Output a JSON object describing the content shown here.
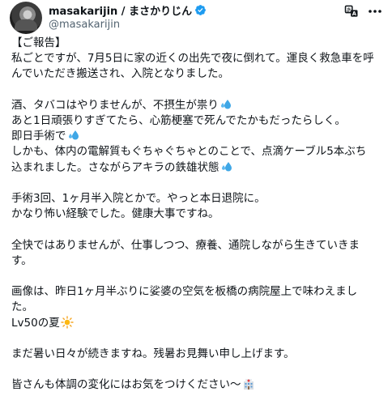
{
  "author": {
    "display_name": "masakarijin / まさかりじん",
    "handle": "@masakarijin",
    "verified_icon": "verified-badge-icon",
    "verified_color": "#1d9bf0"
  },
  "actions": {
    "translate_icon": "translate-icon",
    "more_icon": "more-icon"
  },
  "post": {
    "paragraphs": [
      [
        "【ご報告】",
        "私ごとですが、7月5日に家の近くの出先で夜に倒れて。運良く救急車を呼",
        "んでいただき搬送され、入院となりました。"
      ],
      [
        "酒、タバコはやりませんが、不摂生が祟り",
        "あと1日頑張りすぎてたら、心筋梗塞で死んでたかもだったらしく。",
        "即日手術で",
        "しかも、体内の電解質もぐちゃぐちゃとのことで、点滴ケーブル5本ぶち",
        "込まれました。さながらアキラの鉄雄状態"
      ],
      [
        "手術3回、1ヶ月半入院とかで。やっと本日退院に。",
        "かなり怖い経験でした。健康大事ですね。"
      ],
      [
        "全快ではありませんが、仕事しつつ、療養、通院しながら生きていきま",
        "す。"
      ],
      [
        "画像は、昨日1ヶ月半ぶりに娑婆の空気を板橋の病院屋上で味わえまし",
        "た。",
        "Lv50の夏"
      ],
      [
        "まだ暑い日々が続きますね。残暑お見舞い申し上げます。"
      ],
      [
        "皆さんも体調の変化にはお気をつけください〜"
      ]
    ],
    "emoji_sweat": "sweat-droplets-emoji",
    "emoji_sun": "sun-emoji",
    "emoji_hospital": "hospital-emoji"
  }
}
